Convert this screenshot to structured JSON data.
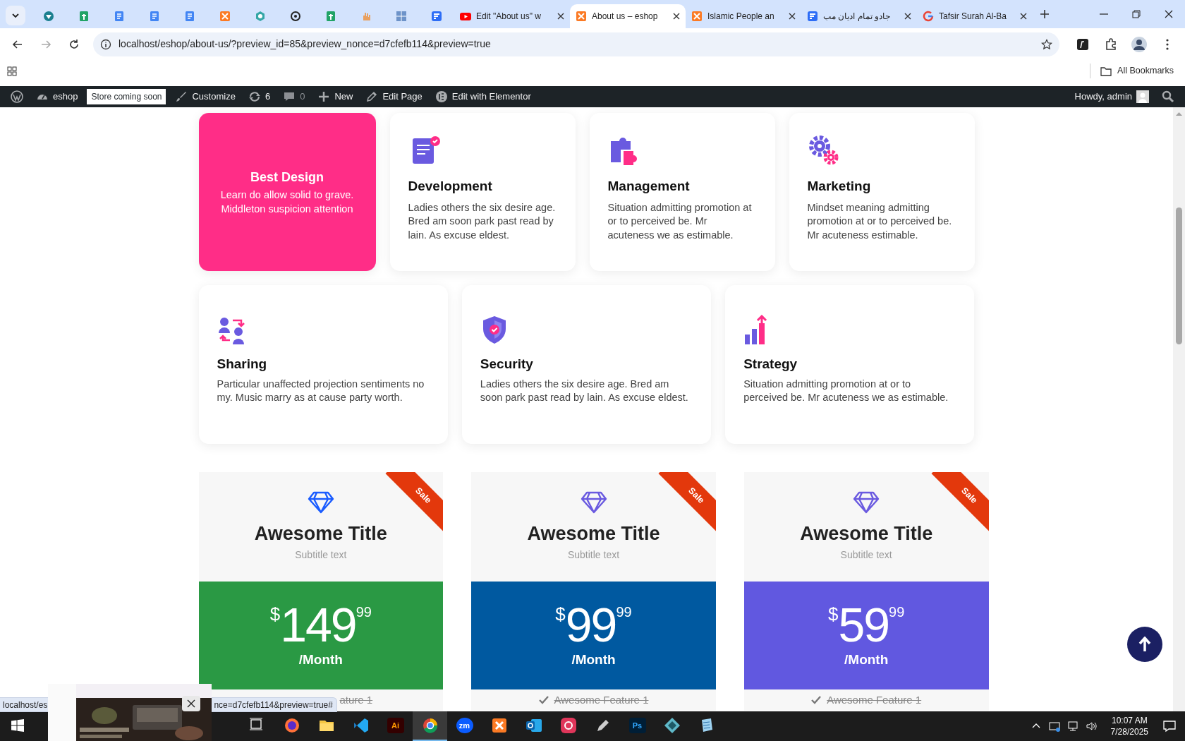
{
  "browser": {
    "tabs": [
      {
        "selected": false
      },
      {
        "selected": false
      },
      {
        "selected": false
      },
      {
        "selected": false
      },
      {
        "selected": false
      },
      {
        "selected": false
      },
      {
        "selected": false
      },
      {
        "selected": false
      },
      {
        "selected": false
      },
      {
        "selected": false
      },
      {
        "selected": false
      },
      {
        "selected": false
      },
      {
        "title": "Edit \"About us\" w",
        "selected": false
      },
      {
        "title": "About us – eshop",
        "selected": true
      },
      {
        "title": "Islamic People an",
        "selected": false
      },
      {
        "title": "جادو تمام ادیان مب",
        "selected": false
      },
      {
        "title": "Tafsir Surah Al-Ba",
        "selected": false
      }
    ],
    "url": "localhost/eshop/about-us/?preview_id=85&preview_nonce=d7cfefb114&preview=true",
    "bookmarks": [
      "All Bookmarks"
    ]
  },
  "admin_bar": {
    "site": "eshop",
    "badge": "Store coming soon",
    "items": [
      {
        "label": "Customize"
      },
      {
        "label": "6"
      },
      {
        "label": "0"
      },
      {
        "label": "New"
      },
      {
        "label": "Edit Page"
      },
      {
        "label": "Edit with Elementor"
      }
    ],
    "greeting": "Howdy, admin"
  },
  "features_row_1": [
    {
      "title": "Best Design",
      "text": "Learn do allow solid to grave. Middleton suspicion attention",
      "highlighted": true
    },
    {
      "title": "Development",
      "text": "Ladies others the six desire age. Bred am soon park past read by lain. As excuse eldest.",
      "highlighted": false
    },
    {
      "title": "Management",
      "text": "Situation admitting promotion at or to perceived be. Mr acuteness we as estimable.",
      "highlighted": false
    },
    {
      "title": "Marketing",
      "text": "Mindset meaning admitting promotion at or to perceived be. Mr acuteness estimable.",
      "highlighted": false
    }
  ],
  "features_row_2": [
    {
      "title": "Sharing",
      "text": "Particular unaffected projection sentiments no my. Music marry as at cause party worth.",
      "highlighted": false
    },
    {
      "title": "Security",
      "text": "Ladies others the six desire age. Bred am soon park past read by lain. As excuse eldest.",
      "highlighted": false
    },
    {
      "title": "Strategy",
      "text": "Situation admitting promotion at or to perceived be. Mr acuteness we as estimable.",
      "highlighted": false
    }
  ],
  "plans": [
    {
      "title": "Awesome Title",
      "subtitle": "Subtitle text",
      "ribbon": "Sale",
      "currency": "$",
      "amount": "149",
      "cents": "99",
      "period": "/Month",
      "color": "#2a9944",
      "feature": "ature 1",
      "check_icon": false
    },
    {
      "title": "Awesome Title",
      "subtitle": "Subtitle text",
      "ribbon": "Sale",
      "currency": "$",
      "amount": "99",
      "cents": "99",
      "period": "/Month",
      "color": "#0059a0",
      "feature": "Awesome Feature 1",
      "check_icon": true
    },
    {
      "title": "Awesome Title",
      "subtitle": "Subtitle text",
      "ribbon": "Sale",
      "currency": "$",
      "amount": "59",
      "cents": "99",
      "period": "/Month",
      "color": "#6158e0",
      "feature": "Awesome Feature 1",
      "check_icon": true
    }
  ],
  "status_bar": {
    "texts": [
      "localhost/es",
      "nce=d7cfefb114&preview=true#"
    ]
  },
  "taskbar": {
    "apps": [
      {
        "selected": false
      },
      {
        "selected": false
      },
      {
        "selected": false
      },
      {
        "selected": false
      },
      {
        "label": "Ai",
        "selected": false
      },
      {
        "selected": true
      },
      {
        "label": "zm",
        "selected": false
      },
      {
        "selected": false
      },
      {
        "selected": false
      },
      {
        "selected": false
      },
      {
        "selected": false
      },
      {
        "label": "Ps",
        "selected": false
      },
      {
        "selected": false
      },
      {
        "selected": false
      }
    ],
    "time": "10:07 AM",
    "date": "7/28/2025"
  }
}
